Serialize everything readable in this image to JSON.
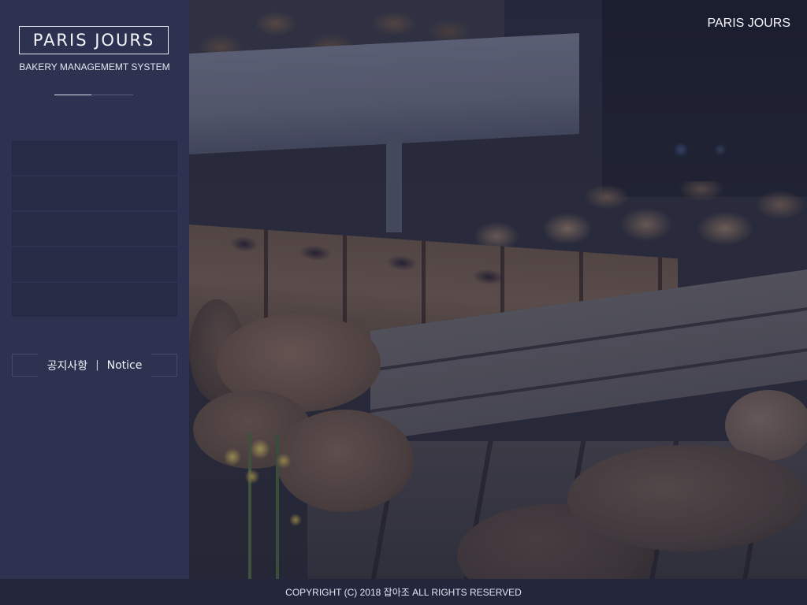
{
  "header": {
    "brand_right": "PARIS JOURS"
  },
  "sidebar": {
    "logo_title": "PARIS JOURS",
    "logo_subtitle": "BAKERY MANAGEMEMT SYSTEM",
    "menu_items": [
      {
        "label": ""
      },
      {
        "label": ""
      },
      {
        "label": ""
      },
      {
        "label": ""
      },
      {
        "label": ""
      }
    ],
    "notice": {
      "korean": "공지사항",
      "separator": "|",
      "english": "Notice"
    }
  },
  "footer": {
    "copyright": "COPYRIGHT (C) 2018 잡아조 ALL RIGHTS RESERVED"
  },
  "colors": {
    "sidebar_bg": "#2d3250",
    "menu_item_bg": "#272b45",
    "footer_bg": "#24273c",
    "text_light": "#f1f2f7"
  }
}
